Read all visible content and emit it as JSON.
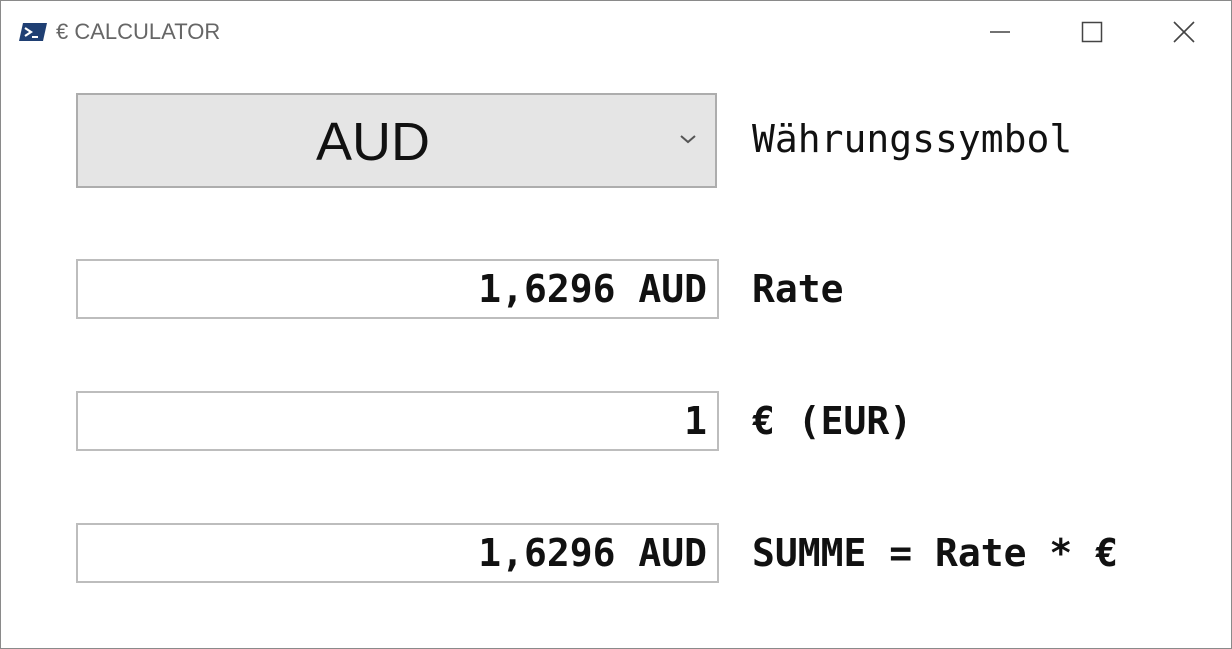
{
  "window": {
    "title": "€ CALCULATOR",
    "icon": "powershell-icon"
  },
  "currency_select": {
    "selected": "AUD",
    "label": "Währungssymbol"
  },
  "rate": {
    "value": "1,6296 AUD",
    "label": "Rate"
  },
  "euro": {
    "value": "1",
    "label": "€ (EUR)"
  },
  "sum": {
    "value": "1,6296 AUD",
    "label": "SUMME = Rate * €"
  }
}
